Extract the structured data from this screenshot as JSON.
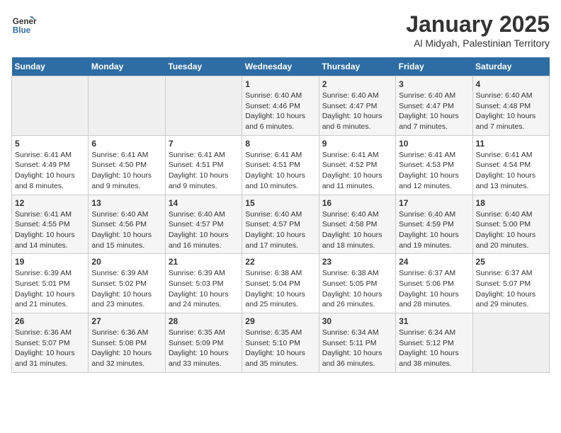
{
  "header": {
    "logo_line1": "General",
    "logo_line2": "Blue",
    "title": "January 2025",
    "subtitle": "Al Midyah, Palestinian Territory"
  },
  "days_of_week": [
    "Sunday",
    "Monday",
    "Tuesday",
    "Wednesday",
    "Thursday",
    "Friday",
    "Saturday"
  ],
  "weeks": [
    [
      {
        "day": "",
        "content": ""
      },
      {
        "day": "",
        "content": ""
      },
      {
        "day": "",
        "content": ""
      },
      {
        "day": "1",
        "content": "Sunrise: 6:40 AM\nSunset: 4:46 PM\nDaylight: 10 hours and 6 minutes."
      },
      {
        "day": "2",
        "content": "Sunrise: 6:40 AM\nSunset: 4:47 PM\nDaylight: 10 hours and 6 minutes."
      },
      {
        "day": "3",
        "content": "Sunrise: 6:40 AM\nSunset: 4:47 PM\nDaylight: 10 hours and 7 minutes."
      },
      {
        "day": "4",
        "content": "Sunrise: 6:40 AM\nSunset: 4:48 PM\nDaylight: 10 hours and 7 minutes."
      }
    ],
    [
      {
        "day": "5",
        "content": "Sunrise: 6:41 AM\nSunset: 4:49 PM\nDaylight: 10 hours and 8 minutes."
      },
      {
        "day": "6",
        "content": "Sunrise: 6:41 AM\nSunset: 4:50 PM\nDaylight: 10 hours and 9 minutes."
      },
      {
        "day": "7",
        "content": "Sunrise: 6:41 AM\nSunset: 4:51 PM\nDaylight: 10 hours and 9 minutes."
      },
      {
        "day": "8",
        "content": "Sunrise: 6:41 AM\nSunset: 4:51 PM\nDaylight: 10 hours and 10 minutes."
      },
      {
        "day": "9",
        "content": "Sunrise: 6:41 AM\nSunset: 4:52 PM\nDaylight: 10 hours and 11 minutes."
      },
      {
        "day": "10",
        "content": "Sunrise: 6:41 AM\nSunset: 4:53 PM\nDaylight: 10 hours and 12 minutes."
      },
      {
        "day": "11",
        "content": "Sunrise: 6:41 AM\nSunset: 4:54 PM\nDaylight: 10 hours and 13 minutes."
      }
    ],
    [
      {
        "day": "12",
        "content": "Sunrise: 6:41 AM\nSunset: 4:55 PM\nDaylight: 10 hours and 14 minutes."
      },
      {
        "day": "13",
        "content": "Sunrise: 6:40 AM\nSunset: 4:56 PM\nDaylight: 10 hours and 15 minutes."
      },
      {
        "day": "14",
        "content": "Sunrise: 6:40 AM\nSunset: 4:57 PM\nDaylight: 10 hours and 16 minutes."
      },
      {
        "day": "15",
        "content": "Sunrise: 6:40 AM\nSunset: 4:57 PM\nDaylight: 10 hours and 17 minutes."
      },
      {
        "day": "16",
        "content": "Sunrise: 6:40 AM\nSunset: 4:58 PM\nDaylight: 10 hours and 18 minutes."
      },
      {
        "day": "17",
        "content": "Sunrise: 6:40 AM\nSunset: 4:59 PM\nDaylight: 10 hours and 19 minutes."
      },
      {
        "day": "18",
        "content": "Sunrise: 6:40 AM\nSunset: 5:00 PM\nDaylight: 10 hours and 20 minutes."
      }
    ],
    [
      {
        "day": "19",
        "content": "Sunrise: 6:39 AM\nSunset: 5:01 PM\nDaylight: 10 hours and 21 minutes."
      },
      {
        "day": "20",
        "content": "Sunrise: 6:39 AM\nSunset: 5:02 PM\nDaylight: 10 hours and 23 minutes."
      },
      {
        "day": "21",
        "content": "Sunrise: 6:39 AM\nSunset: 5:03 PM\nDaylight: 10 hours and 24 minutes."
      },
      {
        "day": "22",
        "content": "Sunrise: 6:38 AM\nSunset: 5:04 PM\nDaylight: 10 hours and 25 minutes."
      },
      {
        "day": "23",
        "content": "Sunrise: 6:38 AM\nSunset: 5:05 PM\nDaylight: 10 hours and 26 minutes."
      },
      {
        "day": "24",
        "content": "Sunrise: 6:37 AM\nSunset: 5:06 PM\nDaylight: 10 hours and 28 minutes."
      },
      {
        "day": "25",
        "content": "Sunrise: 6:37 AM\nSunset: 5:07 PM\nDaylight: 10 hours and 29 minutes."
      }
    ],
    [
      {
        "day": "26",
        "content": "Sunrise: 6:36 AM\nSunset: 5:07 PM\nDaylight: 10 hours and 31 minutes."
      },
      {
        "day": "27",
        "content": "Sunrise: 6:36 AM\nSunset: 5:08 PM\nDaylight: 10 hours and 32 minutes."
      },
      {
        "day": "28",
        "content": "Sunrise: 6:35 AM\nSunset: 5:09 PM\nDaylight: 10 hours and 33 minutes."
      },
      {
        "day": "29",
        "content": "Sunrise: 6:35 AM\nSunset: 5:10 PM\nDaylight: 10 hours and 35 minutes."
      },
      {
        "day": "30",
        "content": "Sunrise: 6:34 AM\nSunset: 5:11 PM\nDaylight: 10 hours and 36 minutes."
      },
      {
        "day": "31",
        "content": "Sunrise: 6:34 AM\nSunset: 5:12 PM\nDaylight: 10 hours and 38 minutes."
      },
      {
        "day": "",
        "content": ""
      }
    ]
  ]
}
